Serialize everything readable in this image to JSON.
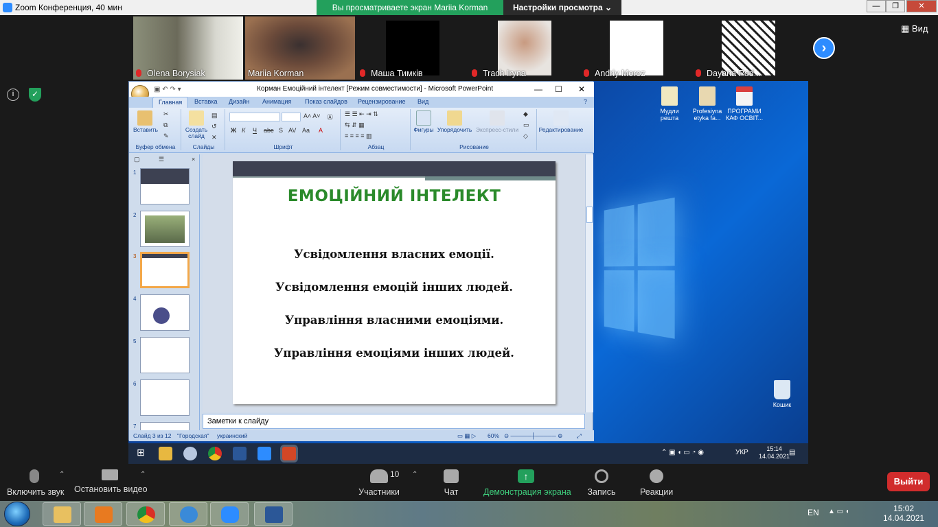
{
  "zoom": {
    "window_title": "Zoom Конференция, 40 мин",
    "share_banner": "Вы просматриваете экран Mariia Korman",
    "view_options": "Настройки просмотра",
    "view_label": "Вид",
    "participants": [
      {
        "name": "Olena Borysiak",
        "muted": true
      },
      {
        "name": "Mariia Korman",
        "muted": false
      },
      {
        "name": "Маша Тимків",
        "muted": true
      },
      {
        "name": "Trach Iryna",
        "muted": true
      },
      {
        "name": "Andriy Moroz",
        "muted": true
      },
      {
        "name": "Dayana Pod...",
        "muted": true
      }
    ],
    "controls": {
      "mute": "Включить звук",
      "video": "Остановить видео",
      "participants": "Участники",
      "participants_count": "10",
      "chat": "Чат",
      "share": "Демонстрация экрана",
      "record": "Запись",
      "reactions": "Реакции",
      "leave": "Выйти"
    }
  },
  "powerpoint": {
    "title": "Корман Емоційний інтелект [Режим совместимости] - Microsoft PowerPoint",
    "tabs": [
      "Главная",
      "Вставка",
      "Дизайн",
      "Анимация",
      "Показ слайдов",
      "Рецензирование",
      "Вид"
    ],
    "groups": {
      "clipboard": "Буфер обмена",
      "paste": "Вставить",
      "slides": "Слайды",
      "new_slide": "Создать слайд",
      "font": "Шрифт",
      "paragraph": "Абзац",
      "drawing": "Рисование",
      "shapes": "Фигуры",
      "arrange": "Упорядочить",
      "quick_styles": "Экспресс-стили",
      "editing": "Редактирование"
    },
    "thumb_numbers": [
      "1",
      "2",
      "3",
      "4",
      "5",
      "6",
      "7"
    ],
    "slide": {
      "title": "ЕМОЦІЙНИЙ ІНТЕЛЕКТ",
      "lines": [
        "Усвідомлення власних емоції.",
        "Усвідомлення емоцій інших людей.",
        "Управління власними емоціями.",
        "Управління емоціями інших людей."
      ]
    },
    "notes_placeholder": "Заметки к слайду",
    "status": {
      "slide_of": "Слайд 3 из 12",
      "theme": "\"Городская\"",
      "language": "украинский",
      "zoom": "60%"
    }
  },
  "remote_desktop": {
    "icons": [
      {
        "label": "Мудли решта"
      },
      {
        "label": "Profesiyna etyka fa..."
      },
      {
        "label": "ПРОГРАМИ КАФ ОСВІТ..."
      },
      {
        "label": "Кошик"
      }
    ],
    "lang": "УКР",
    "time": "15:14",
    "date": "14.04.2021"
  },
  "local_taskbar": {
    "lang": "EN",
    "time": "15:02",
    "date": "14.04.2021"
  }
}
